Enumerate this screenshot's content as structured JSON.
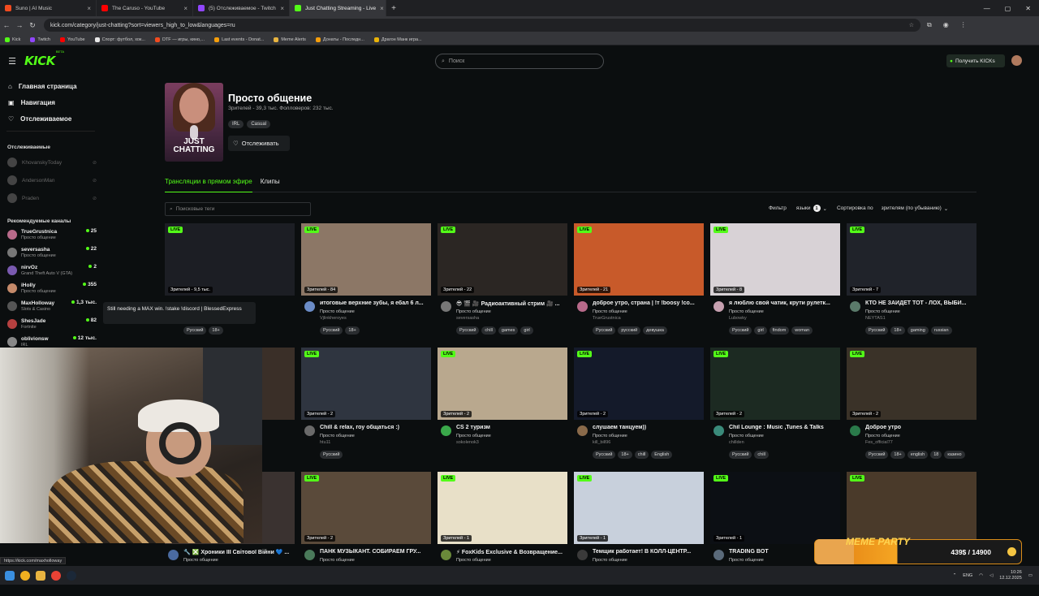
{
  "browser": {
    "tabs": [
      {
        "label": "Suno | AI Music",
        "color": "#f24b1f"
      },
      {
        "label": "The Caruso - YouTube",
        "color": "#ff0000"
      },
      {
        "label": "(5) Отслеживаемое - Twitch",
        "color": "#9146ff"
      },
      {
        "label": "Just Chatting Streaming - Live",
        "color": "#53fc18"
      }
    ],
    "url": "kick.com/category/just-chatting?sort=viewers_high_to_low&languages=ru",
    "bookmarks": [
      "Kick",
      "Twitch",
      "YouTube",
      "Спорт: футбол, хок...",
      "DTF — игры, кино,...",
      "Last events - Donat...",
      "Meme Alerts",
      "Донаты - Последн...",
      "Драгон Манк игра..."
    ],
    "status_url": "https://kick.com/maxholloway"
  },
  "kick": {
    "logo": "KICK",
    "beta": "BETA",
    "search_placeholder": "Поиск",
    "get_kicks": "Получить KICKs",
    "accent": "#53fc18"
  },
  "sidebar": {
    "nav": [
      {
        "label": "Главная страница",
        "icon": "home-icon"
      },
      {
        "label": "Навигация",
        "icon": "compass-icon"
      },
      {
        "label": "Отслеживаемое",
        "icon": "heart-icon"
      }
    ],
    "following_title": "Отслеживаемые",
    "following": [
      "KhovanskyToday",
      "AndersonMan",
      "Praden"
    ],
    "recommended_title": "Рекомендуемые каналы",
    "recommended": [
      {
        "name": "TrueGrustnica",
        "category": "Просто общение",
        "viewers": "25",
        "color": "#b86a8a"
      },
      {
        "name": "seversasha",
        "category": "Просто общение",
        "viewers": "22",
        "color": "#777"
      },
      {
        "name": "nirvOz",
        "category": "Grand Theft Auto V (GTA)",
        "viewers": "2",
        "color": "#7a5ab0"
      },
      {
        "name": "iHolly",
        "category": "Просто общение",
        "viewers": "355",
        "color": "#c58a6a"
      },
      {
        "name": "MaxHolloway",
        "category": "Slots & Casino",
        "viewers": "1,3 тыс.",
        "color": "#555"
      },
      {
        "name": "ShesJade",
        "category": "Fortnite",
        "viewers": "82",
        "color": "#b54040"
      },
      {
        "name": "oblivionsw",
        "category": "IRL",
        "viewers": "12 тыс.",
        "color": "#888"
      }
    ],
    "tooltip": "Still needing a MAX win. !stake !discord | BlessedExpress"
  },
  "category": {
    "cover_text": "JUST CHATTING",
    "title": "Просто общение",
    "stats": "Зрителей - 39,3 тыс.   Фолловеров: 232 тыс.",
    "tags": [
      "IRL",
      "Casual"
    ],
    "follow_label": "Отслеживать",
    "tabs": [
      "Трансляции в прямом эфире",
      "Клипы"
    ],
    "tag_search_placeholder": "Поисковые теги",
    "filter_label": "Фильтр",
    "languages_label": "языки",
    "languages_count": "1",
    "sort_label": "Сортировка по",
    "sort_value": "зрителям (по убыванию)"
  },
  "streams": [
    {
      "viewers": "Зрителей - 9,5 тыс.",
      "title": "",
      "category": "",
      "user": "",
      "tags": [
        "Русский",
        "18+"
      ],
      "thumb": "#1c1e24",
      "av": "#444"
    },
    {
      "viewers": "Зрителей - 84",
      "title": "итоговые верхние зубы, я ебал 6 л...",
      "category": "Просто общение",
      "user": "Vjlinkheroyes",
      "tags": [
        "Русский",
        "18+"
      ],
      "thumb": "#8c7766",
      "av": "#6b8cc7"
    },
    {
      "viewers": "Зрителей - 22",
      "title": "😎 🎬 🎥 Радиоактивный стрим 🎥 ...",
      "category": "Просто общение",
      "user": "seversasha",
      "tags": [
        "Русский",
        "chill",
        "games",
        "girl"
      ],
      "thumb": "#2b2623",
      "av": "#777"
    },
    {
      "viewers": "Зрителей - 21",
      "title": "доброе утро, страна | !т !boosy !co...",
      "category": "Просто общение",
      "user": "TrueGrustnica",
      "tags": [
        "Русский",
        "русский",
        "девушка"
      ],
      "thumb": "#c85a2a",
      "av": "#b86a8a"
    },
    {
      "viewers": "Зрителей - 8",
      "title": "я люблю свой чатик, крути рулетк...",
      "category": "Просто общение",
      "user": "Lubowky",
      "tags": [
        "Русский",
        "girl",
        "findom",
        "woman"
      ],
      "thumb": "#d8d2d6",
      "av": "#c6a0b0"
    },
    {
      "viewers": "Зрителей - 7",
      "title": "КТО НЕ ЗАЙДЁТ ТОТ - ЛОХ, ВЫБИ...",
      "category": "Просто общение",
      "user": "NEYTAS1",
      "tags": [
        "Русский",
        "18+",
        "gaming",
        "russian"
      ],
      "thumb": "#20232a",
      "av": "#5a7a6a"
    },
    {
      "viewers": "",
      "title": "",
      "category": "",
      "user": "",
      "tags": [],
      "thumb": "#3a2f28",
      "av": "#444"
    },
    {
      "viewers": "Зрителей - 2",
      "title": "Chill & relax, гоу общаться :)",
      "category": "Просто общение",
      "user": "htu11",
      "tags": [
        "Русский"
      ],
      "thumb": "#2f3540",
      "av": "#6a6a6a"
    },
    {
      "viewers": "Зрителей - 2",
      "title": "CS 2 туризм",
      "category": "Просто общение",
      "user": "sokolenok3",
      "tags": [],
      "thumb": "#b9a88e",
      "av": "#3aa84a"
    },
    {
      "viewers": "Зрителей - 2",
      "title": "слушаем танцуем))",
      "category": "Просто общение",
      "user": "kill_bill96",
      "tags": [
        "Русский",
        "18+",
        "chill",
        "English"
      ],
      "thumb": "#141a2a",
      "av": "#8a6a4a"
    },
    {
      "viewers": "Зрителей - 2",
      "title": "Chil Lounge : Music ,Tunes & Talks",
      "category": "Просто общение",
      "user": "chillden",
      "tags": [
        "Русский",
        "chill"
      ],
      "thumb": "#1c2a22",
      "av": "#3a8a7a"
    },
    {
      "viewers": "Зрителей - 2",
      "title": "Доброе утро",
      "category": "Просто общение",
      "user": "Fes_official77",
      "tags": [
        "Русский",
        "18+",
        "english",
        "18",
        "казино"
      ],
      "thumb": "#3a3228",
      "av": "#2a7a4a"
    },
    {
      "viewers": "",
      "title": "🔧 ❎ Хроники III Світової Війни 💙 ...",
      "category": "Просто общение",
      "user": "",
      "tags": [],
      "thumb": "#3a3230",
      "av": "#4a6aa0"
    },
    {
      "viewers": "Зрителей - 2",
      "title": "ПАНК МУЗЫКАНТ. СОБИРАЕМ ГРУ...",
      "category": "Просто общение",
      "user": "",
      "tags": [],
      "thumb": "#5a4a3a",
      "av": "#4a7a5a"
    },
    {
      "viewers": "Зрителей - 1",
      "title": "⚡ FoxKids Exclusive & Возвращение...",
      "category": "Просто общение",
      "user": "",
      "tags": [],
      "thumb": "#e8e0c8",
      "av": "#6a8a3a"
    },
    {
      "viewers": "Зрителей - 1",
      "title": "Темщик работает! В КОЛЛ-ЦЕНТР...",
      "category": "Просто общение",
      "user": "",
      "tags": [],
      "thumb": "#c8d0dc",
      "av": "#3a3a3a"
    },
    {
      "viewers": "Зрителей - 1",
      "title": "TRADING BOT",
      "category": "Просто общение",
      "user": "",
      "tags": [],
      "thumb": "#0c0f14",
      "av": "#5a6a7a"
    },
    {
      "viewers": "",
      "title": "",
      "category": "",
      "user": "",
      "tags": [],
      "thumb": "#4a3a2a",
      "av": "#444"
    }
  ],
  "overlay": {
    "meme_title": "MEME PARTY",
    "progress": "439$ / 14900"
  },
  "taskbar": {
    "lang": "ENG",
    "time": "10:26",
    "date": "12.12.2025"
  }
}
